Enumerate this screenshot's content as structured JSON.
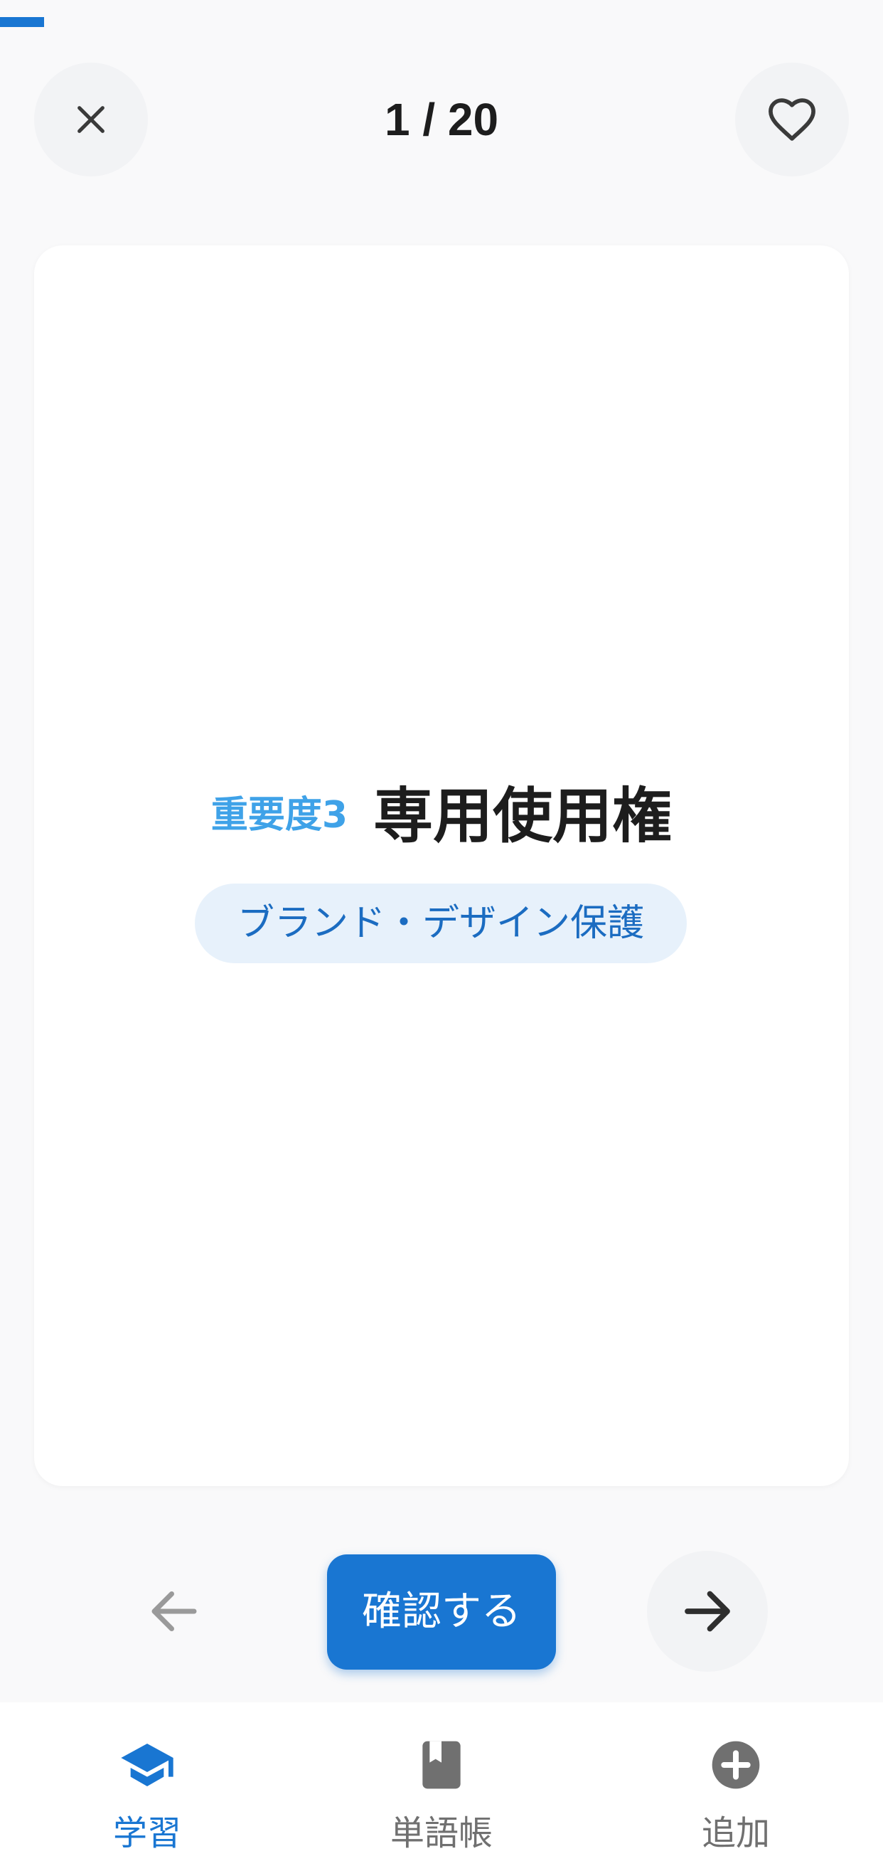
{
  "progress": {
    "current": 1,
    "total": 20
  },
  "header": {
    "counter_text": "1 / 20"
  },
  "card": {
    "importance_label": "重要度3",
    "term": "専用使用権",
    "category": "ブランド・デザイン保護"
  },
  "controls": {
    "confirm_label": "確認する"
  },
  "bottom_nav": {
    "items": [
      {
        "label": "学習",
        "icon": "graduation-cap-icon",
        "active": true
      },
      {
        "label": "単語帳",
        "icon": "book-icon",
        "active": false
      },
      {
        "label": "追加",
        "icon": "plus-circle-icon",
        "active": false
      }
    ]
  },
  "colors": {
    "accent": "#1976d2",
    "importance": "#3fa2e8",
    "chip_bg": "#e7f1fb",
    "chip_text": "#1b6cc1",
    "inactive": "#707070"
  }
}
